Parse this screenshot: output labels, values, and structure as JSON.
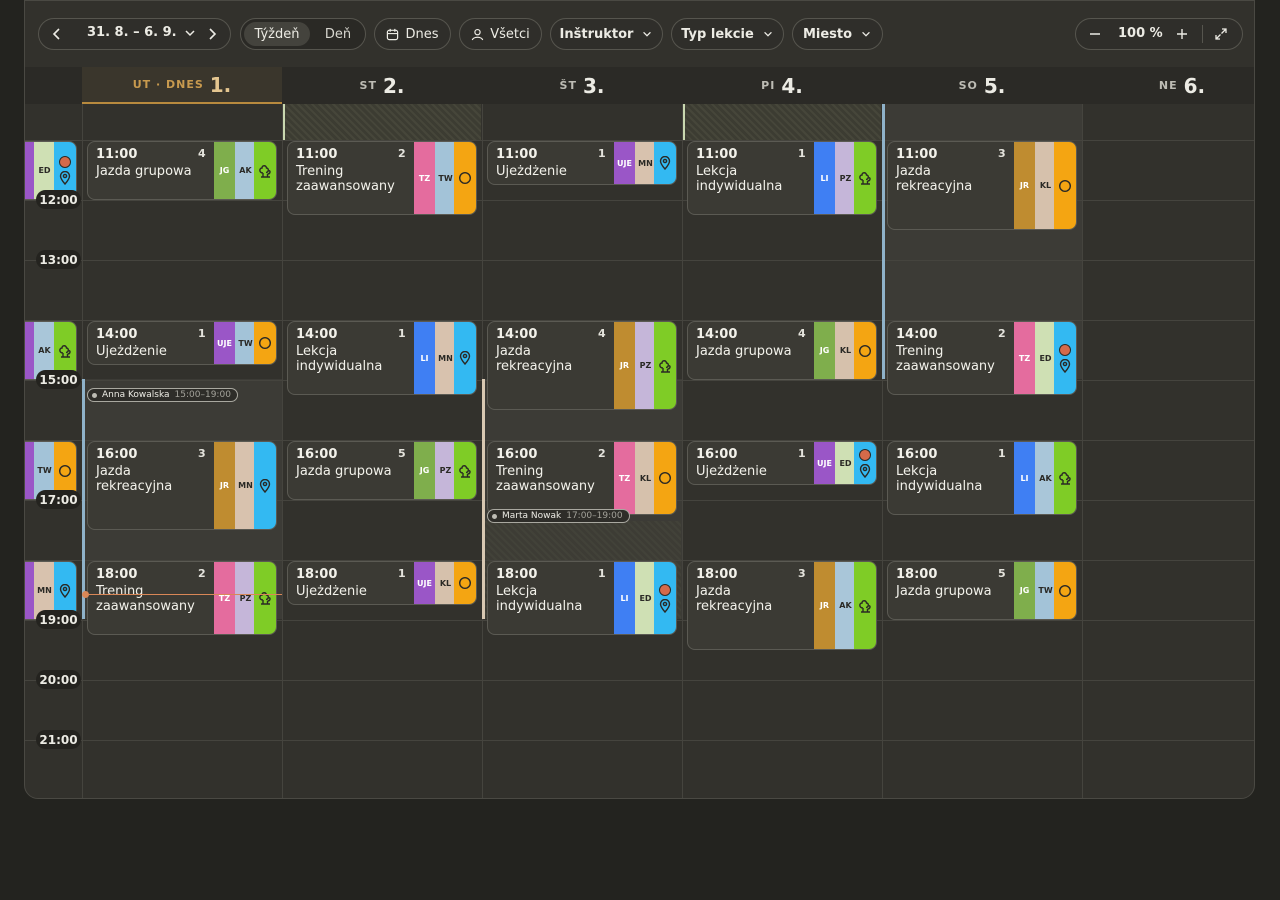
{
  "toolbar": {
    "range": "31. 8. – 6. 9.",
    "view_week": "Týždeň",
    "view_day": "Deň",
    "today": "Dnes",
    "all": "Všetci",
    "filter_instructor": "Inštruktor",
    "filter_type": "Typ lekcie",
    "filter_place": "Miesto",
    "zoom": "100 %"
  },
  "days": [
    {
      "label": "UT · DNES",
      "num": "1.",
      "today": true
    },
    {
      "label": "ST",
      "num": "2."
    },
    {
      "label": "ŠT",
      "num": "3."
    },
    {
      "label": "PI",
      "num": "4."
    },
    {
      "label": "SO",
      "num": "5."
    },
    {
      "label": "NE",
      "num": "6."
    }
  ],
  "times": [
    "12:00",
    "13:00",
    "15:00",
    "17:00",
    "19:00",
    "20:00",
    "21:00"
  ],
  "tags": [
    {
      "name": "Anna Kowalska",
      "time": "15:00–19:00"
    },
    {
      "name": "Marta Nowak",
      "time": "17:00–19:00"
    }
  ],
  "colors": {
    "JG": "#7fae4c",
    "AK": "#a9c6d9",
    "TW": "#a3c3d8",
    "MN": "#d8c2ae",
    "PZ": "#c5b6d9",
    "KL": "#d6c1ac",
    "ED": "#cfe0b4",
    "JR": "#bf8c30",
    "TZ": "#e46c9e",
    "UJE": "#9a56c7",
    "LI": "#3f7ff3",
    "pin": "#33b9f2",
    "tree": "#7fcc26",
    "ring": "#f4a512"
  },
  "events": [
    {
      "day": 0,
      "time": "11:00",
      "count": "4",
      "name": "Jazda grupowa",
      "codes": [
        "JG",
        "AK"
      ],
      "icon": "tree",
      "dot": false
    },
    {
      "day": 0,
      "time": "14:00",
      "count": "1",
      "name": "Ujeżdżenie",
      "codes": [
        "UJE",
        "TW"
      ],
      "icon": "ring",
      "dot": false
    },
    {
      "day": 0,
      "time": "16:00",
      "count": "3",
      "name": "Jazda rekreacyjna",
      "codes": [
        "JR",
        "MN"
      ],
      "icon": "pin",
      "dot": false
    },
    {
      "day": 0,
      "time": "18:00",
      "count": "2",
      "name": "Trening zaawansowany",
      "codes": [
        "TZ",
        "PZ"
      ],
      "icon": "tree",
      "dot": false
    },
    {
      "day": 1,
      "time": "11:00",
      "count": "2",
      "name": "Trening zaawansowany",
      "codes": [
        "TZ",
        "TW"
      ],
      "icon": "ring",
      "dot": false
    },
    {
      "day": 1,
      "time": "14:00",
      "count": "1",
      "name": "Lekcja indywidualna",
      "codes": [
        "LI",
        "MN"
      ],
      "icon": "pin",
      "dot": false
    },
    {
      "day": 1,
      "time": "16:00",
      "count": "5",
      "name": "Jazda grupowa",
      "codes": [
        "JG",
        "PZ"
      ],
      "icon": "tree",
      "dot": false
    },
    {
      "day": 1,
      "time": "18:00",
      "count": "1",
      "name": "Ujeżdżenie",
      "codes": [
        "UJE",
        "KL"
      ],
      "icon": "ring",
      "dot": false
    },
    {
      "day": 2,
      "time": "11:00",
      "count": "1",
      "name": "Ujeżdżenie",
      "codes": [
        "UJE",
        "MN"
      ],
      "icon": "pin",
      "dot": false
    },
    {
      "day": 2,
      "time": "14:00",
      "count": "4",
      "name": "Jazda rekreacyjna",
      "codes": [
        "JR",
        "PZ"
      ],
      "icon": "tree",
      "dot": false
    },
    {
      "day": 2,
      "time": "16:00",
      "count": "2",
      "name": "Trening zaawansowany",
      "codes": [
        "TZ",
        "KL"
      ],
      "icon": "ring",
      "dot": false
    },
    {
      "day": 2,
      "time": "18:00",
      "count": "1",
      "name": "Lekcja indywidualna",
      "codes": [
        "LI",
        "ED"
      ],
      "icon": "pin",
      "dot": true
    },
    {
      "day": 3,
      "time": "11:00",
      "count": "1",
      "name": "Lekcja indywidualna",
      "codes": [
        "LI",
        "PZ"
      ],
      "icon": "tree",
      "dot": false
    },
    {
      "day": 3,
      "time": "14:00",
      "count": "4",
      "name": "Jazda grupowa",
      "codes": [
        "JG",
        "KL"
      ],
      "icon": "ring",
      "dot": false
    },
    {
      "day": 3,
      "time": "16:00",
      "count": "1",
      "name": "Ujeżdżenie",
      "codes": [
        "UJE",
        "ED"
      ],
      "icon": "pin",
      "dot": true
    },
    {
      "day": 3,
      "time": "18:00",
      "count": "3",
      "name": "Jazda rekreacyjna",
      "codes": [
        "JR",
        "AK"
      ],
      "icon": "tree",
      "dot": false
    },
    {
      "day": 4,
      "time": "11:00",
      "count": "3",
      "name": "Jazda rekreacyjna",
      "codes": [
        "JR",
        "KL"
      ],
      "icon": "ring",
      "dot": false
    },
    {
      "day": 4,
      "time": "14:00",
      "count": "2",
      "name": "Trening zaawansowany",
      "codes": [
        "TZ",
        "ED"
      ],
      "icon": "pin",
      "dot": true
    },
    {
      "day": 4,
      "time": "16:00",
      "count": "1",
      "name": "Lekcja indywidualna",
      "codes": [
        "LI",
        "AK"
      ],
      "icon": "tree",
      "dot": false
    },
    {
      "day": 4,
      "time": "18:00",
      "count": "5",
      "name": "Jazda grupowa",
      "codes": [
        "JG",
        "TW"
      ],
      "icon": "ring",
      "dot": false
    }
  ],
  "partial_events": [
    {
      "time_slot": "11:00",
      "codes": [
        "ED"
      ],
      "icon": "pin",
      "dot": true
    },
    {
      "time_slot": "14:00",
      "codes": [
        "AK"
      ],
      "icon": "tree",
      "dot": false
    },
    {
      "time_slot": "16:00",
      "codes": [
        "TW"
      ],
      "icon": "ring",
      "dot": false
    },
    {
      "time_slot": "18:00",
      "codes": [
        "MN"
      ],
      "icon": "pin",
      "dot": false
    }
  ]
}
